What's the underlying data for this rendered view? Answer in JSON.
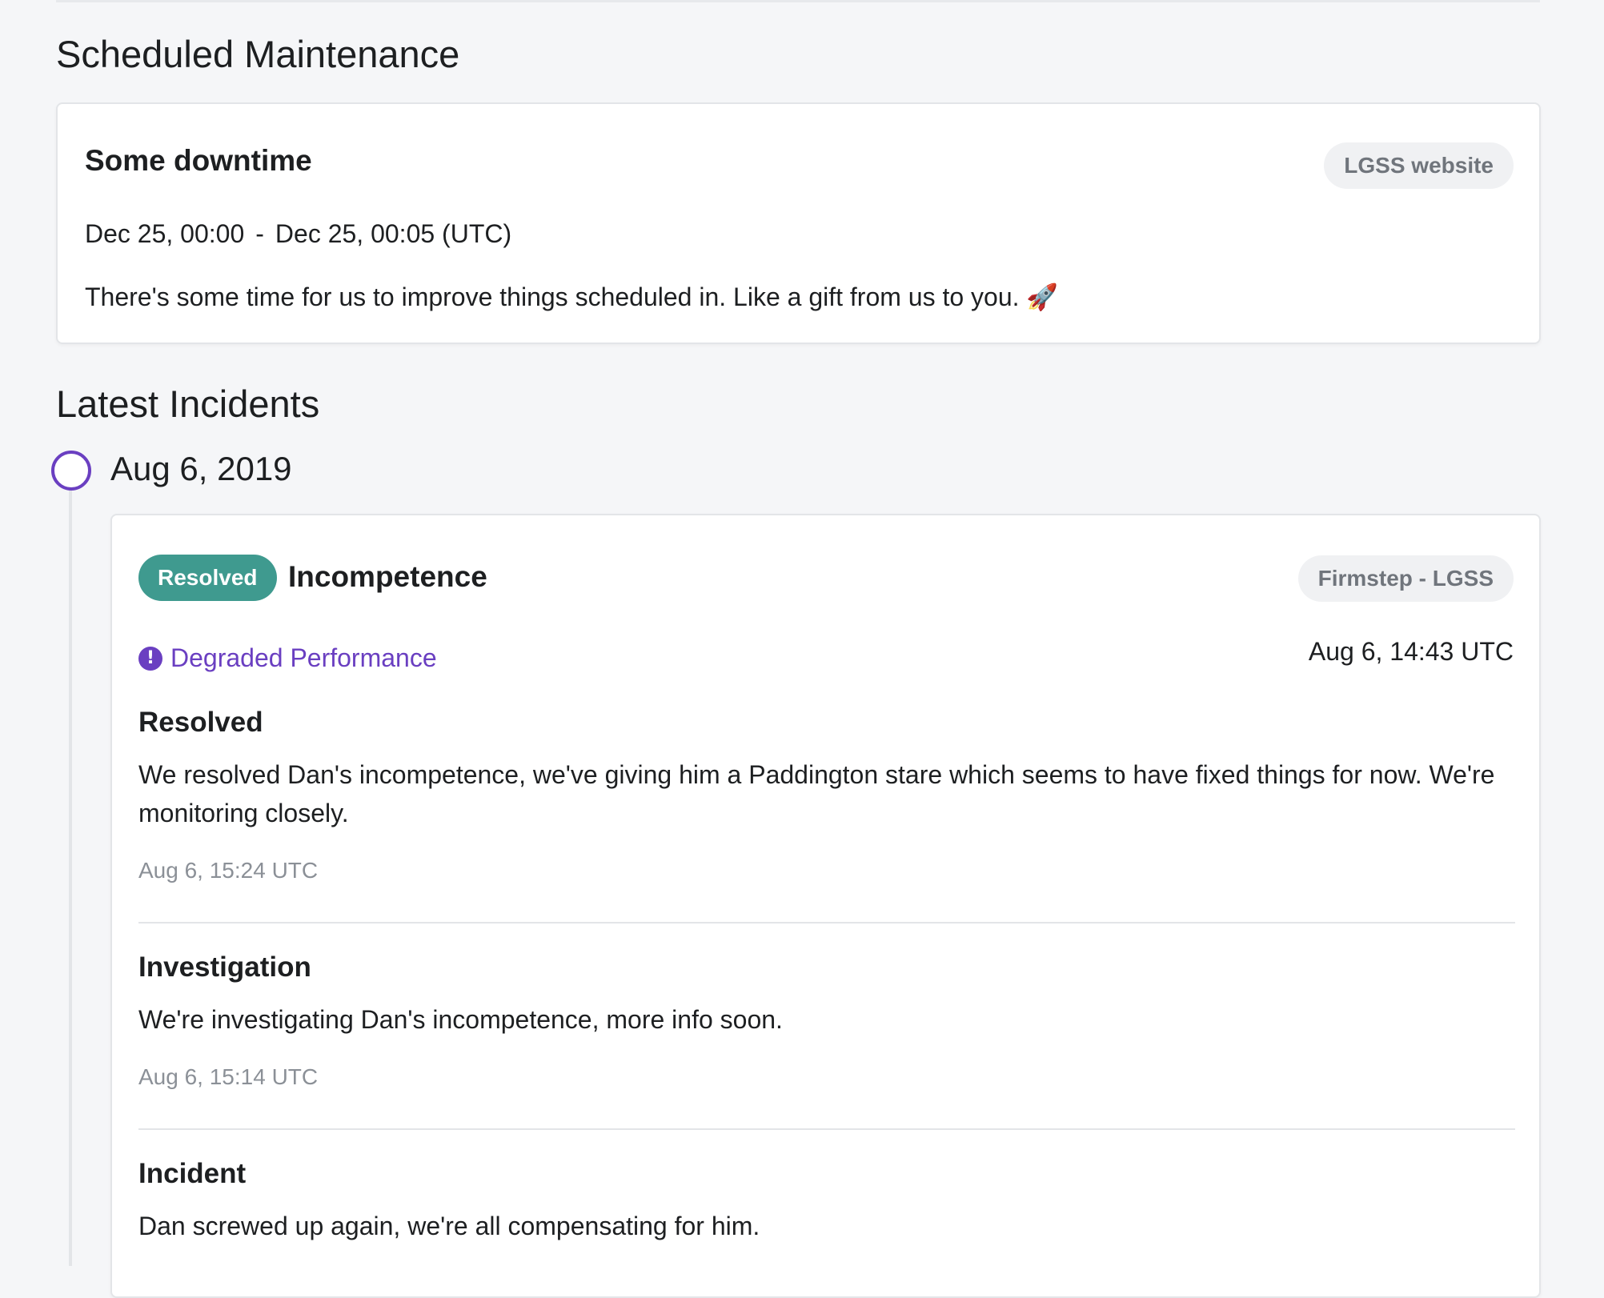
{
  "maintenance": {
    "section_title": "Scheduled Maintenance",
    "title": "Some downtime",
    "component": "LGSS website",
    "start": "Dec 25, 00:00",
    "separator": "-",
    "end": "Dec 25, 00:05",
    "timezone": "(UTC)",
    "description": "There's some time for us to improve things scheduled in. Like a gift from us to you. 🚀"
  },
  "incidents": {
    "section_title": "Latest Incidents",
    "date": "Aug 6, 2019",
    "incident": {
      "status": "Resolved",
      "title": "Incompetence",
      "component": "Firmstep - LGSS",
      "impact": "Degraded Performance",
      "impact_icon": "exclamation-circle-icon",
      "started": "Aug 6, 14:43 UTC",
      "updates": [
        {
          "title": "Resolved",
          "body": "We resolved Dan's incompetence, we've giving him a Paddington stare which seems to have fixed things for now. We're monitoring closely.",
          "time": "Aug 6, 15:24 UTC"
        },
        {
          "title": "Investigation",
          "body": "We're investigating Dan's incompetence, more info soon.",
          "time": "Aug 6, 15:14 UTC"
        },
        {
          "title": "Incident",
          "body": "Dan screwed up again, we're all compensating for him."
        }
      ]
    }
  },
  "colors": {
    "accent_purple": "#6a3fc1",
    "resolved_green": "#3f9a8f",
    "page_background": "#f5f6f8"
  }
}
